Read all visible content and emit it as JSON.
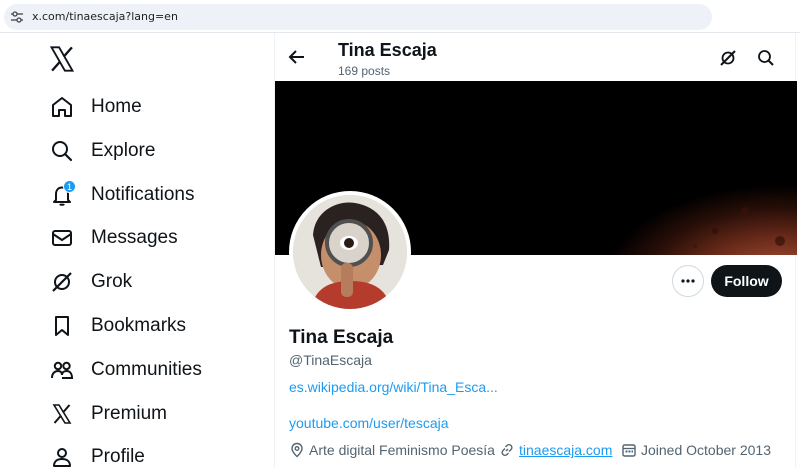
{
  "browser": {
    "url": "x.com/tinaescaja?lang=en"
  },
  "sidebar": {
    "items": [
      {
        "label": "Home",
        "icon": "home-icon"
      },
      {
        "label": "Explore",
        "icon": "search-icon"
      },
      {
        "label": "Notifications",
        "icon": "bell-icon",
        "badge": "1"
      },
      {
        "label": "Messages",
        "icon": "envelope-icon"
      },
      {
        "label": "Grok",
        "icon": "grok-icon"
      },
      {
        "label": "Bookmarks",
        "icon": "bookmark-icon"
      },
      {
        "label": "Communities",
        "icon": "people-icon"
      },
      {
        "label": "Premium",
        "icon": "x-logo-icon"
      },
      {
        "label": "Profile",
        "icon": "person-icon"
      }
    ]
  },
  "header": {
    "name": "Tina Escaja",
    "posts": "169 posts"
  },
  "profile": {
    "name": "Tina Escaja",
    "handle": "@TinaEscaja",
    "link1": "es.wikipedia.org/wiki/Tina_Esca...",
    "link2": "youtube.com/user/tescaja",
    "category": "Arte digital Feminismo Poesía",
    "website": "tinaescaja.com",
    "joined": "Joined October 2013",
    "follow_label": "Follow"
  },
  "colors": {
    "accent": "#1d9bf0",
    "text": "#0f1419",
    "secondary": "#536471"
  }
}
